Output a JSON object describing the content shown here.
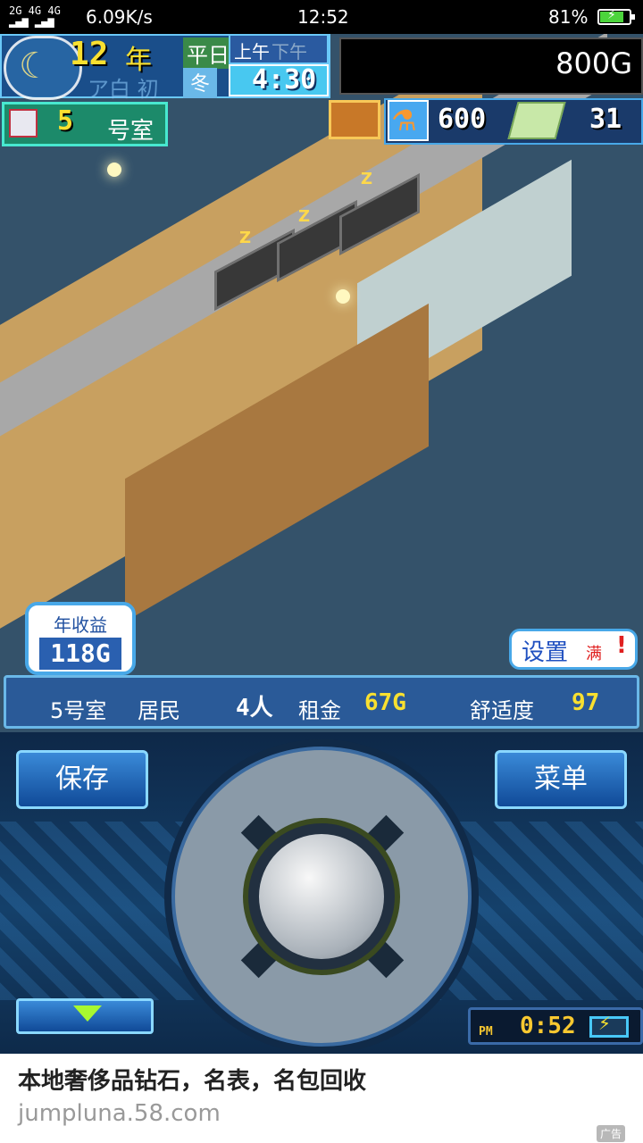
{
  "status_bar": {
    "signal_line1": "2G   4G 4G",
    "signal_line2": "▂▄▆  ▂▄▆",
    "net_speed": "6.09K/s",
    "time": "12:52",
    "battery_percent": "81%",
    "battery_level": 0.81
  },
  "hud": {
    "year_number": "12",
    "year_unit": "年",
    "day_type": "平日",
    "season": "冬",
    "week_text": "ア白 初",
    "am_label": "上午",
    "pm_label": "下午",
    "clock": "4:30",
    "gold": "800G",
    "room_number": "5",
    "room_label": "号室",
    "research_points": "600",
    "tickets": "31"
  },
  "scene": {
    "zz": [
      "Z",
      "Z",
      "Z"
    ]
  },
  "income": {
    "label": "年收益",
    "value": "118G"
  },
  "settings": {
    "label": "设置",
    "full": "满",
    "alert": "!"
  },
  "info_bar": {
    "room": "5号室",
    "resident_label": "居民",
    "people": "4人",
    "rent_label": "租金",
    "rent": "67G",
    "comfort_label": "舒适度",
    "comfort": "97"
  },
  "controls": {
    "save_label": "保存",
    "menu_label": "菜单",
    "pm": "PM",
    "game_time": "0:52"
  },
  "ad": {
    "title": "本地奢侈品钻石，名表，名包回收",
    "url": "jumpluna.58.com",
    "tag": "广告"
  },
  "colors": {
    "accent_blue": "#48a8e8",
    "gold_text": "#f8e030",
    "battery_green": "#4cd43c"
  }
}
